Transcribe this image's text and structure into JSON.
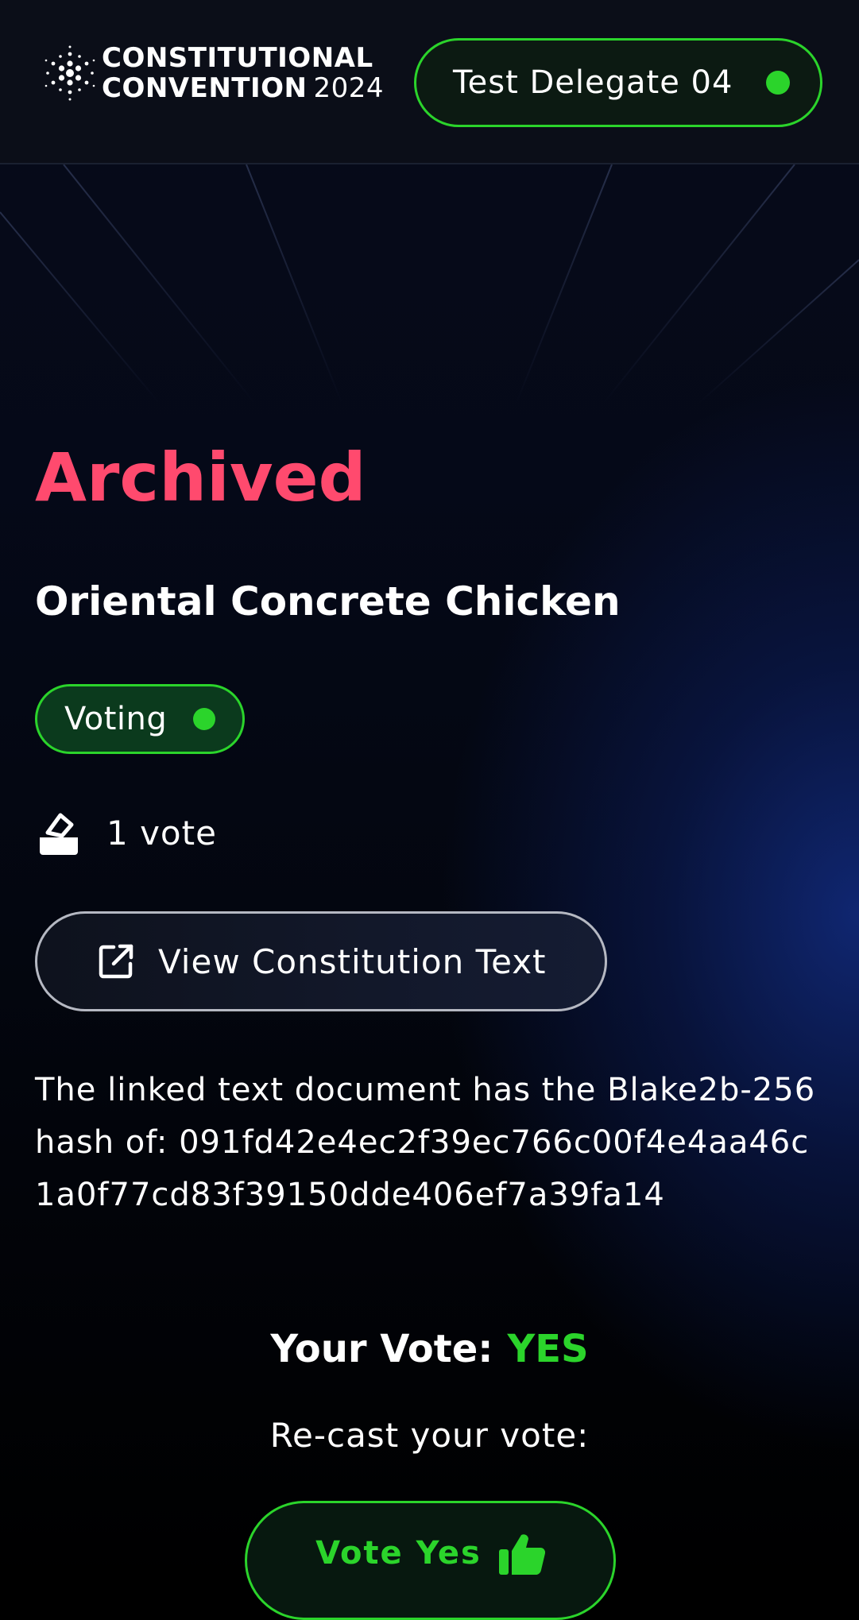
{
  "header": {
    "logo_line1": "CONSTITUTIONAL",
    "logo_line2": "CONVENTION",
    "logo_year": "2024",
    "logo_icon": "cardano-dots-icon",
    "delegate_name": "Test Delegate 04",
    "delegate_status_color": "#2bd42b"
  },
  "proposal": {
    "status": "Archived",
    "status_color": "#ff4a6e",
    "title": "Oriental Concrete Chicken",
    "phase_label": "Voting",
    "phase_color": "#2bd42b",
    "vote_count": "1 vote",
    "vote_icon": "ballot-box-icon",
    "view_text_label": "View Constitution Text",
    "view_text_icon": "external-link-icon",
    "hash_description": "The linked text document has the Blake2b-256 hash of: 091fd42e4ec2f39ec766c00f4e4aa46c1a0f77cd83f39150dde406ef7a39fa14"
  },
  "vote": {
    "label": "Your Vote:",
    "value": "YES",
    "value_color": "#2bd42b",
    "recast_label": "Re-cast your vote:",
    "yes_button_label": "Vote Yes",
    "yes_button_icon": "thumbs-up-icon"
  }
}
